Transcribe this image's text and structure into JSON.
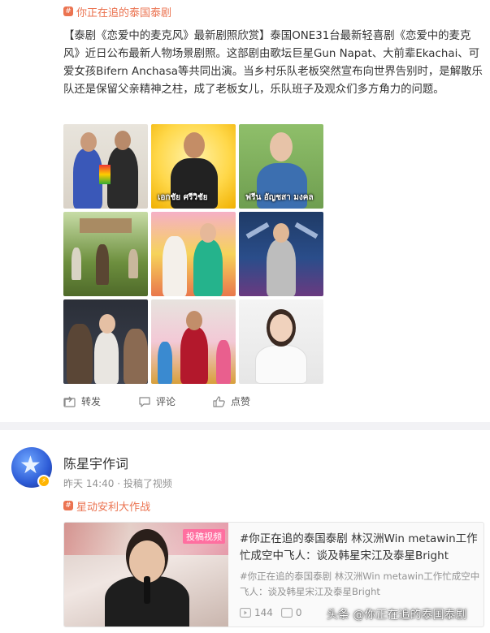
{
  "post1": {
    "topic": "你正在追的泰国泰剧",
    "text": "【泰剧《恋爱中的麦克风》最新剧照欣赏】泰国ONE31台最新轻喜剧《恋爱中的麦克风》近日公布最新人物场景剧照。这部剧由歌坛巨星Gun Napat、大前辈Ekachai、可爱女孩Bifern Anchasa等共同出演。当乡村乐队老板突然宣布向世界告别时，是解散乐队还是保留父亲精神之柱，成了老板女儿，乐队班子及观众们多方角力的问题。",
    "photo_captions": {
      "photo2": "เอกชัย ศรีวิชัย",
      "photo3": "ฟรีน อัญชสา มงคล"
    },
    "actions": {
      "repost": "转发",
      "comment": "评论",
      "like": "点赞"
    }
  },
  "post2": {
    "username": "陈星宇作词",
    "meta": "昨天 14:40 · 投稿了视频",
    "topic": "星动安利大作战",
    "video": {
      "badge": "投稿视频",
      "title": "#你正在追的泰国泰剧 林汉洲Win metawin工作忙成空中飞人：谈及韩星宋江及泰星Bright",
      "desc": "#你正在追的泰国泰剧 林汉洲Win metawin工作忙成空中飞人：谈及韩星宋江及泰星Bright",
      "plays": "144",
      "comments": "0"
    }
  },
  "watermark": "头条 @你正在追的泰国泰剧",
  "colors": {
    "accent": "#eb7350",
    "text": "#333333",
    "meta": "#939393",
    "badge": "#ff6fa0",
    "verify": "#ffb400"
  }
}
